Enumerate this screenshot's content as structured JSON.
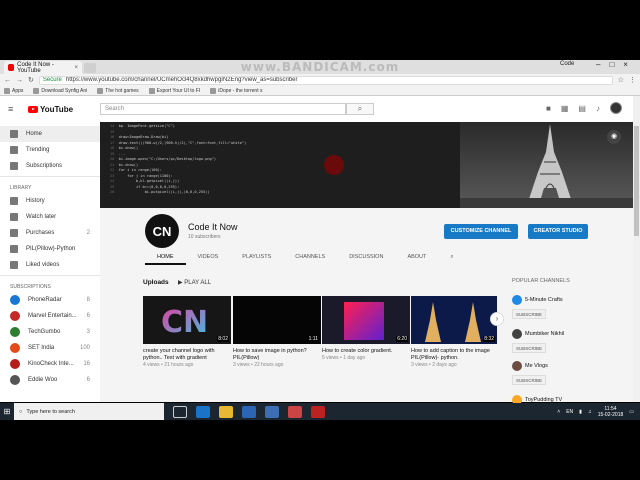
{
  "watermark": "www.BANDICAM.com",
  "browser": {
    "tab_title": "Code It Now - YouTube",
    "user": "Code",
    "secure_label": "Secure",
    "url": "https://www.youtube.com/channel/UCmehOcl4Q8xkdhwpgIN2Eng?view_as=subscriber",
    "bookmarks": [
      "Apps",
      "Download Synfig Ani",
      "The hot games",
      "Export Your UI to FI",
      "iDope - the torrent s"
    ]
  },
  "youtube": {
    "logo_text": "YouTube",
    "search_placeholder": "Search"
  },
  "sidebar": {
    "main": [
      {
        "label": "Home"
      },
      {
        "label": "Trending"
      },
      {
        "label": "Subscriptions"
      }
    ],
    "library_header": "LIBRARY",
    "library": [
      {
        "label": "History",
        "count": ""
      },
      {
        "label": "Watch later",
        "count": ""
      },
      {
        "label": "Purchases",
        "count": "2"
      },
      {
        "label": "PIL(Pillow)-Python",
        "count": ""
      },
      {
        "label": "Liked videos",
        "count": ""
      }
    ],
    "subs_header": "SUBSCRIPTIONS",
    "subscriptions": [
      {
        "label": "PhoneRadar",
        "count": "8",
        "color": "#1976d2"
      },
      {
        "label": "Marvel Entertain...",
        "count": "6",
        "color": "#c62828"
      },
      {
        "label": "TechGumbo",
        "count": "3",
        "color": "#2e7d32"
      },
      {
        "label": "SET India",
        "count": "100",
        "color": "#e64a19"
      },
      {
        "label": "KinoCheck Inte...",
        "count": "16",
        "color": "#b71c1c"
      },
      {
        "label": "Eddie Woo",
        "count": "6",
        "color": "#555555"
      }
    ]
  },
  "channel": {
    "logo": "CN",
    "name": "Code It Now",
    "subscribers": "10 subscribers",
    "customize_button": "CUSTOMIZE CHANNEL",
    "studio_button": "CREATOR STUDIO",
    "tabs": [
      "HOME",
      "VIDEOS",
      "PLAYLISTS",
      "CHANNELS",
      "DISCUSSION",
      "ABOUT"
    ]
  },
  "uploads": {
    "title": "Uploads",
    "play_all": "PLAY ALL",
    "videos": [
      {
        "title": "create your channel logo with python.. Text with gradient",
        "meta": "4 views • 21 hours ago",
        "duration": "8:02"
      },
      {
        "title": "How to save image in python? PIL(Pillow)",
        "meta": "3 views • 22 hours ago",
        "duration": "1:11"
      },
      {
        "title": "How to create color gradient.",
        "meta": "5 views • 1 day ago",
        "duration": "6:20"
      },
      {
        "title": "How to add caption to the image PIL(Pillow)- python.",
        "meta": "3 views • 2 days ago",
        "duration": "8:32"
      }
    ]
  },
  "popular": {
    "title": "POPULAR CHANNELS",
    "subscribe_label": "SUBSCRIBE",
    "channels": [
      {
        "name": "5-Minute Crafts",
        "color": "#1e88e5"
      },
      {
        "name": "Mumbiker Nikhil",
        "color": "#424242"
      },
      {
        "name": "Me Vlogs",
        "color": "#6d4c41"
      },
      {
        "name": "ToyPudding TV",
        "color": "#f9a825"
      }
    ]
  },
  "taskbar": {
    "search_placeholder": "Type here to search",
    "lang": "EN",
    "time": "11:54",
    "date": "15-02-2018"
  },
  "code_lines": [
    "bp. ImageFont.getsize(\"C\")",
    "",
    "draw=ImageDraw.Draw(bi)",
    "draw.text(((900-w)/2,(900-h)/2),\"C\",font=font,fill=\"white\")",
    "bi.show()",
    "...",
    "bi.image.open(\"C:/Users/pc/Desktop/logo.png\")",
    "bi.show()",
    "for i in range(100):",
    "    for j in range(1100):",
    "        b,kl.getpixel((i,j))",
    "        if b==(0,0,0,0,255):",
    "            bi.putpixel((i,j),(0,0,0,255))"
  ]
}
